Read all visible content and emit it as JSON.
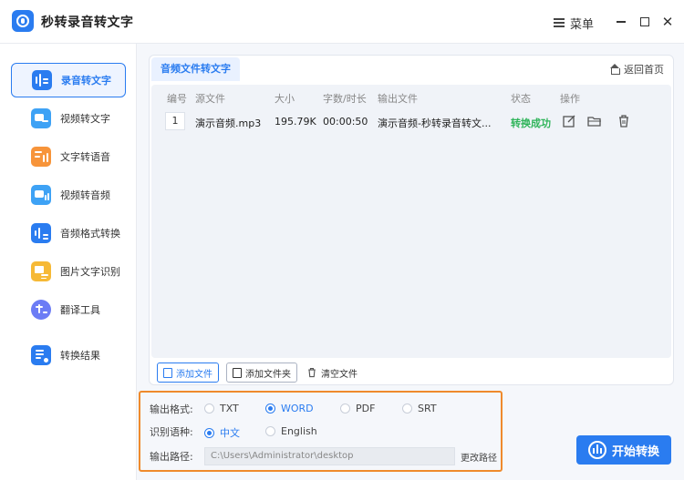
{
  "app": {
    "title": "秒转录音转文字"
  },
  "titlebar": {
    "menu_label": "菜单",
    "minimize": "—",
    "maximize": "☐",
    "close": "✕"
  },
  "sidebar": {
    "items": [
      {
        "label": "录音转文字",
        "icon": "record-to-text-icon"
      },
      {
        "label": "视频转文字",
        "icon": "video-to-text-icon"
      },
      {
        "label": "文字转语音",
        "icon": "text-to-speech-icon"
      },
      {
        "label": "视频转音频",
        "icon": "video-to-audio-icon"
      },
      {
        "label": "音频格式转换",
        "icon": "audio-format-icon"
      },
      {
        "label": "图片文字识别",
        "icon": "image-ocr-icon"
      },
      {
        "label": "翻译工具",
        "icon": "translate-icon"
      },
      {
        "label": "转换结果",
        "icon": "results-icon"
      }
    ]
  },
  "main": {
    "tab_label": "音频文件转文字",
    "home_label": "返回首页",
    "table": {
      "headers": [
        "编号",
        "源文件",
        "大小",
        "字数/时长",
        "输出文件",
        "状态",
        "操作"
      ],
      "rows": [
        {
          "index": "1",
          "source": "演示音频.mp3",
          "size": "195.79K",
          "duration": "00:00:50",
          "output": "演示音频-秒转录音转文...",
          "status": "转换成功"
        }
      ]
    },
    "buttons": {
      "add_file": "添加文件",
      "add_folder": "添加文件夹",
      "clear": "清空文件"
    }
  },
  "settings": {
    "format_label": "输出格式:",
    "formats": [
      "TXT",
      "WORD",
      "PDF",
      "SRT"
    ],
    "selected_format": "WORD",
    "lang_label": "识别语种:",
    "languages": [
      "中文",
      "English"
    ],
    "selected_language": "中文",
    "path_label": "输出路径:",
    "path_value": "C:\\Users\\Administrator\\desktop",
    "change_path": "更改路径"
  },
  "start_button": "开始转换",
  "colors": {
    "accent": "#2a7cf0",
    "success": "#2fb45a",
    "highlight_border": "#ef8a2c"
  }
}
